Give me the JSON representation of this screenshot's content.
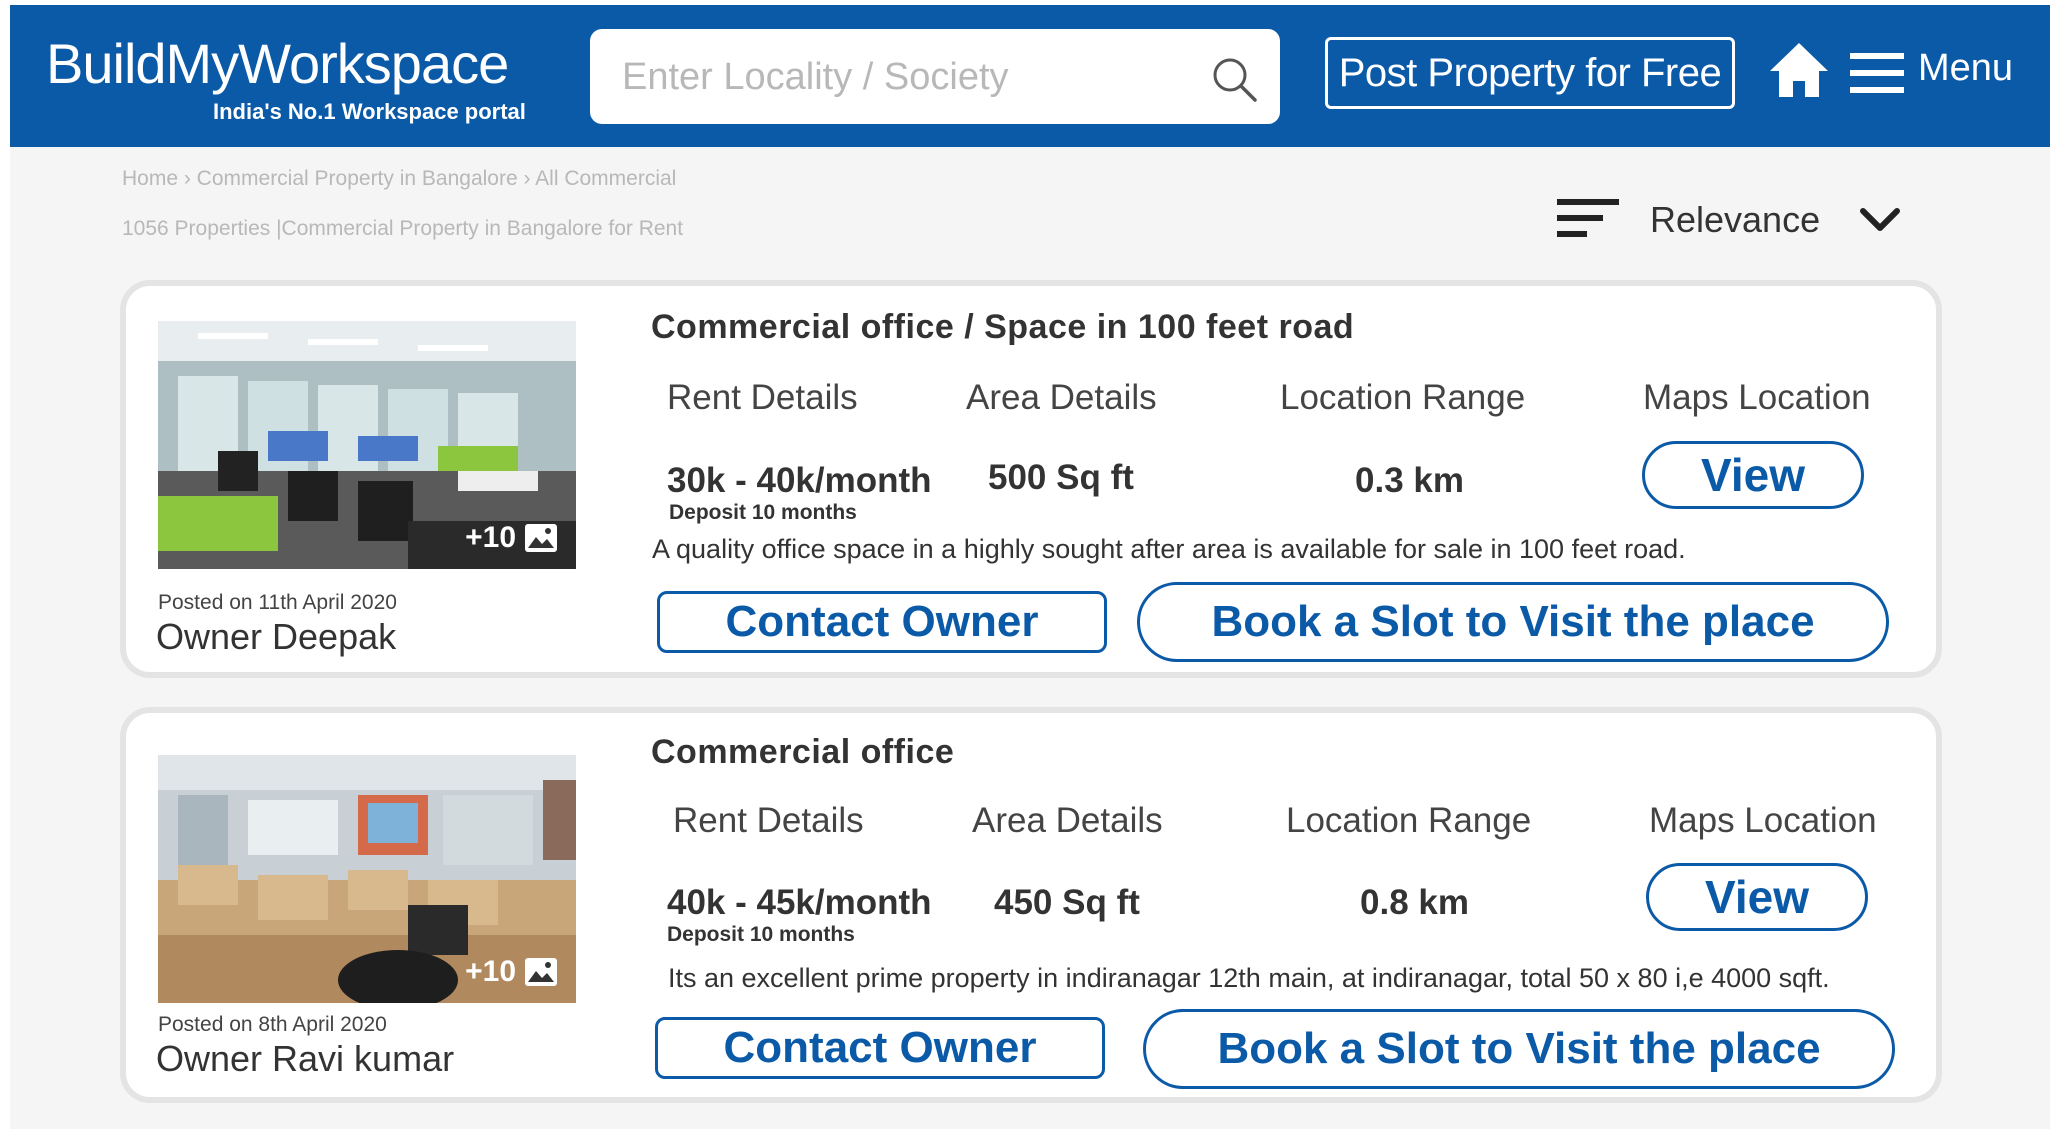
{
  "header": {
    "brand": "BuildMyWorkspace",
    "tagline": "India's No.1 Workspace portal",
    "search_placeholder": "Enter Locality / Society",
    "post_property_label": "Post Property for Free",
    "menu_label": "Menu",
    "bg_color": "#0b5aa8"
  },
  "breadcrumb": {
    "text": "Home › Commercial Property in Bangalore › All  Commercial",
    "results": "1056 Properties |Commercial Property in Bangalore for Rent"
  },
  "sort": {
    "label": "Relevance"
  },
  "icons": {
    "search": "search-icon",
    "home": "home-icon",
    "menu": "menu-icon",
    "sort": "sort-icon",
    "chevron": "chevron-down-icon",
    "image": "image-icon"
  },
  "columns": {
    "rent": "Rent Details",
    "area": "Area Details",
    "location": "Location Range",
    "maps": "Maps Location"
  },
  "listings": [
    {
      "title": "Commercial office / Space in 100  feet road",
      "rent": "30k - 40k/month",
      "deposit": "Deposit 10 months",
      "area": "500 Sq ft",
      "location_range": "0.3 km",
      "view_label": "View",
      "description": "A quality office space in a highly sought after area is available for sale in 100 feet road.",
      "photo_count": "+10",
      "posted": "Posted on 11th April 2020",
      "owner": "Owner Deepak",
      "contact_label": "Contact Owner",
      "book_label": "Book a Slot to Visit the place"
    },
    {
      "title": "Commercial office",
      "rent": "40k - 45k/month",
      "deposit": "Deposit 10 months",
      "area": "450 Sq ft",
      "location_range": "0.8 km",
      "view_label": "View",
      "description": "Its an excellent prime property in indiranagar 12th main, at indiranagar, total 50 x 80 i,e 4000 sqft.",
      "photo_count": "+10",
      "posted": "Posted on 8th April 2020",
      "owner": "Owner Ravi kumar",
      "contact_label": "Contact Owner",
      "book_label": "Book a Slot to Visit the place"
    }
  ]
}
